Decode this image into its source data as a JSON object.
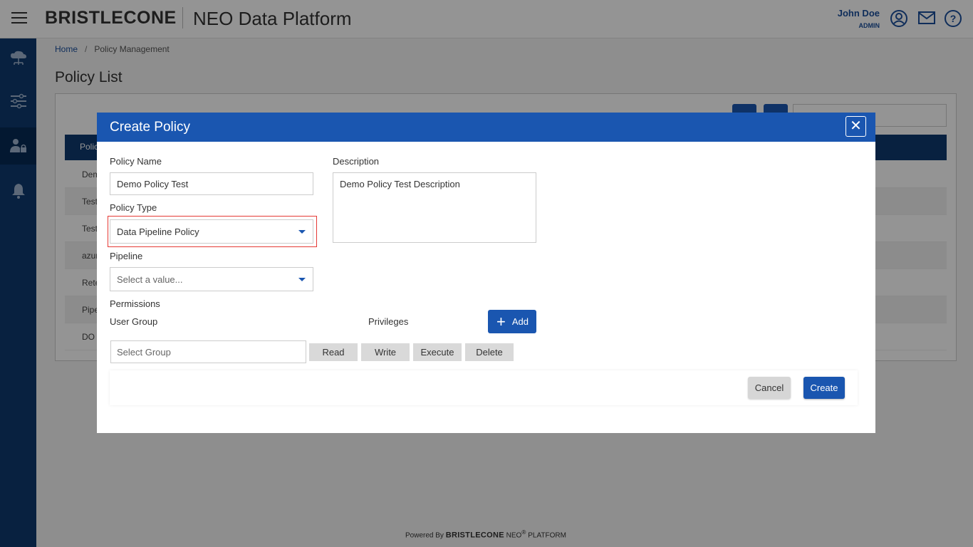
{
  "header": {
    "brand": "BRISTLECONE",
    "app_title": "NEO Data Platform",
    "user_name": "John Doe",
    "user_role": "ADMIN",
    "icons": [
      "user-circle-icon",
      "mail-icon",
      "help-icon"
    ]
  },
  "sidebar": {
    "items": [
      {
        "icon": "cloud-network-icon"
      },
      {
        "icon": "sliders-icon"
      },
      {
        "icon": "user-lock-icon",
        "active": true
      },
      {
        "icon": "bell-icon"
      }
    ]
  },
  "breadcrumb": {
    "home": "Home",
    "separator": "/",
    "current": "Policy Management"
  },
  "page": {
    "title": "Policy List",
    "table_header": "Polic",
    "rows": [
      "Dem",
      "Test",
      "Test",
      "azur",
      "Rete",
      "Pipe",
      "DO P"
    ]
  },
  "modal": {
    "title": "Create Policy",
    "close_label": "✕",
    "policy_name_label": "Policy Name",
    "policy_name_value": "Demo Policy Test",
    "description_label": "Description",
    "description_value": "Demo Policy Test Description",
    "policy_type_label": "Policy Type",
    "policy_type_value": "Data Pipeline Policy",
    "pipeline_label": "Pipeline",
    "pipeline_placeholder": "Select a value...",
    "permissions_label": "Permissions",
    "user_group_label": "User Group",
    "privileges_label": "Privileges",
    "add_label": "Add",
    "select_group_placeholder": "Select Group",
    "privileges": [
      "Read",
      "Write",
      "Execute",
      "Delete"
    ],
    "cancel_label": "Cancel",
    "create_label": "Create"
  },
  "footer": {
    "powered_by": "Powered By",
    "brand": "BRISTLECONE",
    "neo": "NEO",
    "reg": "®",
    "platform": "PLATFORM"
  },
  "colors": {
    "primary": "#1a56b0",
    "sidebar": "#0e3a6e",
    "highlight": "#e53935"
  }
}
